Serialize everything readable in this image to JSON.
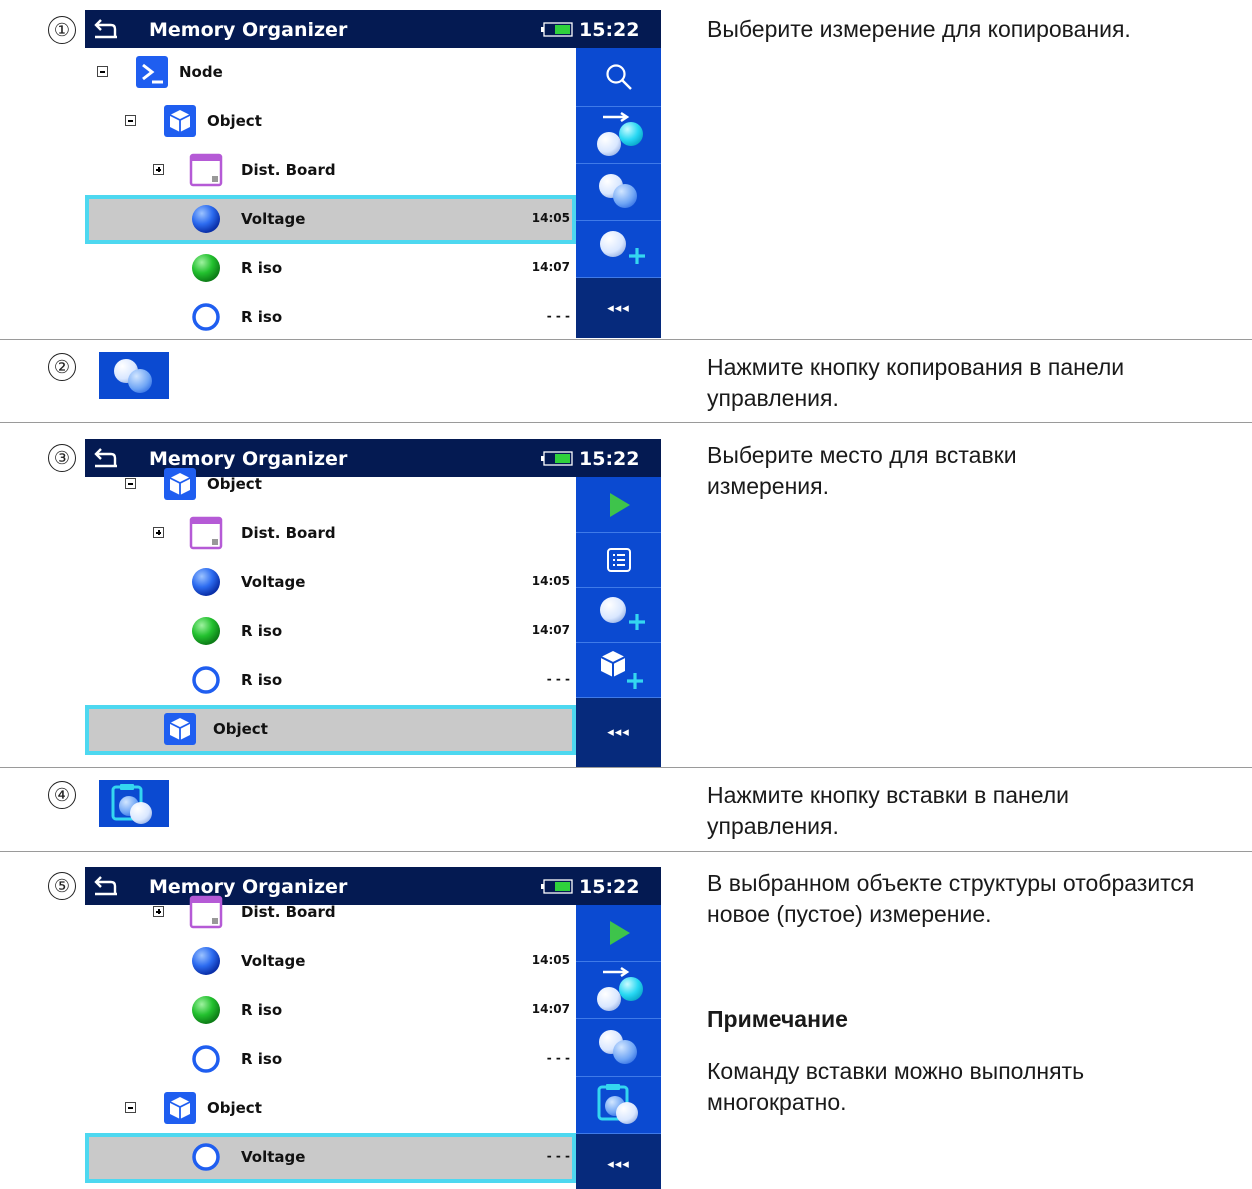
{
  "header": {
    "title": "Memory Organizer",
    "time": "15:22"
  },
  "steps": [
    {
      "num": "①",
      "text": "Выберите измерение для копирования.",
      "rows": [
        {
          "label": "Node",
          "time": ""
        },
        {
          "label": "Object",
          "time": ""
        },
        {
          "label": "Dist. Board",
          "time": ""
        },
        {
          "label": "Voltage",
          "time": "14:05"
        },
        {
          "label": "R iso",
          "time": "14:07"
        },
        {
          "label": "R iso",
          "time": "- - -"
        }
      ],
      "more_label": "◂◂◂"
    },
    {
      "num": "②",
      "text": "Нажмите кнопку копирования в панели управления."
    },
    {
      "num": "③",
      "text": "Выберите место для вставки измерения.",
      "rows": [
        {
          "label": "Object",
          "time": ""
        },
        {
          "label": "Dist. Board",
          "time": ""
        },
        {
          "label": "Voltage",
          "time": "14:05"
        },
        {
          "label": "R iso",
          "time": "14:07"
        },
        {
          "label": "R iso",
          "time": "- - -"
        },
        {
          "label": "Object",
          "time": ""
        }
      ],
      "more_label": "◂◂◂"
    },
    {
      "num": "④",
      "text": "Нажмите кнопку вставки в панели управления."
    },
    {
      "num": "⑤",
      "text": "В выбранном объекте структуры отобразится новое (пустое) измерение.",
      "note_title": "Примечание",
      "note_text": "Команду вставки можно выполнять многократно.",
      "rows": [
        {
          "label": "Dist. Board",
          "time": ""
        },
        {
          "label": "Voltage",
          "time": "14:05"
        },
        {
          "label": "R iso",
          "time": "14:07"
        },
        {
          "label": "R iso",
          "time": "- - -"
        },
        {
          "label": "Object",
          "time": ""
        },
        {
          "label": "Voltage",
          "time": "- - -"
        }
      ],
      "more_label": "◂◂◂"
    }
  ],
  "icons": {
    "node": "terminal-node-icon",
    "object": "object-cube-icon",
    "board": "distribution-board-icon",
    "meas_done_blue": "measurement-blue-icon",
    "meas_pass_green": "measurement-pass-icon",
    "meas_empty": "measurement-empty-icon"
  },
  "colors": {
    "header_bg": "#041a52",
    "sidebar_bg": "#0b4ad1",
    "selection_border": "#4dd8f0",
    "selection_bg": "#c9c9c9",
    "board_purple": "#b55ad6",
    "pass_green": "#22c02e",
    "play_green": "#3ec44b"
  }
}
